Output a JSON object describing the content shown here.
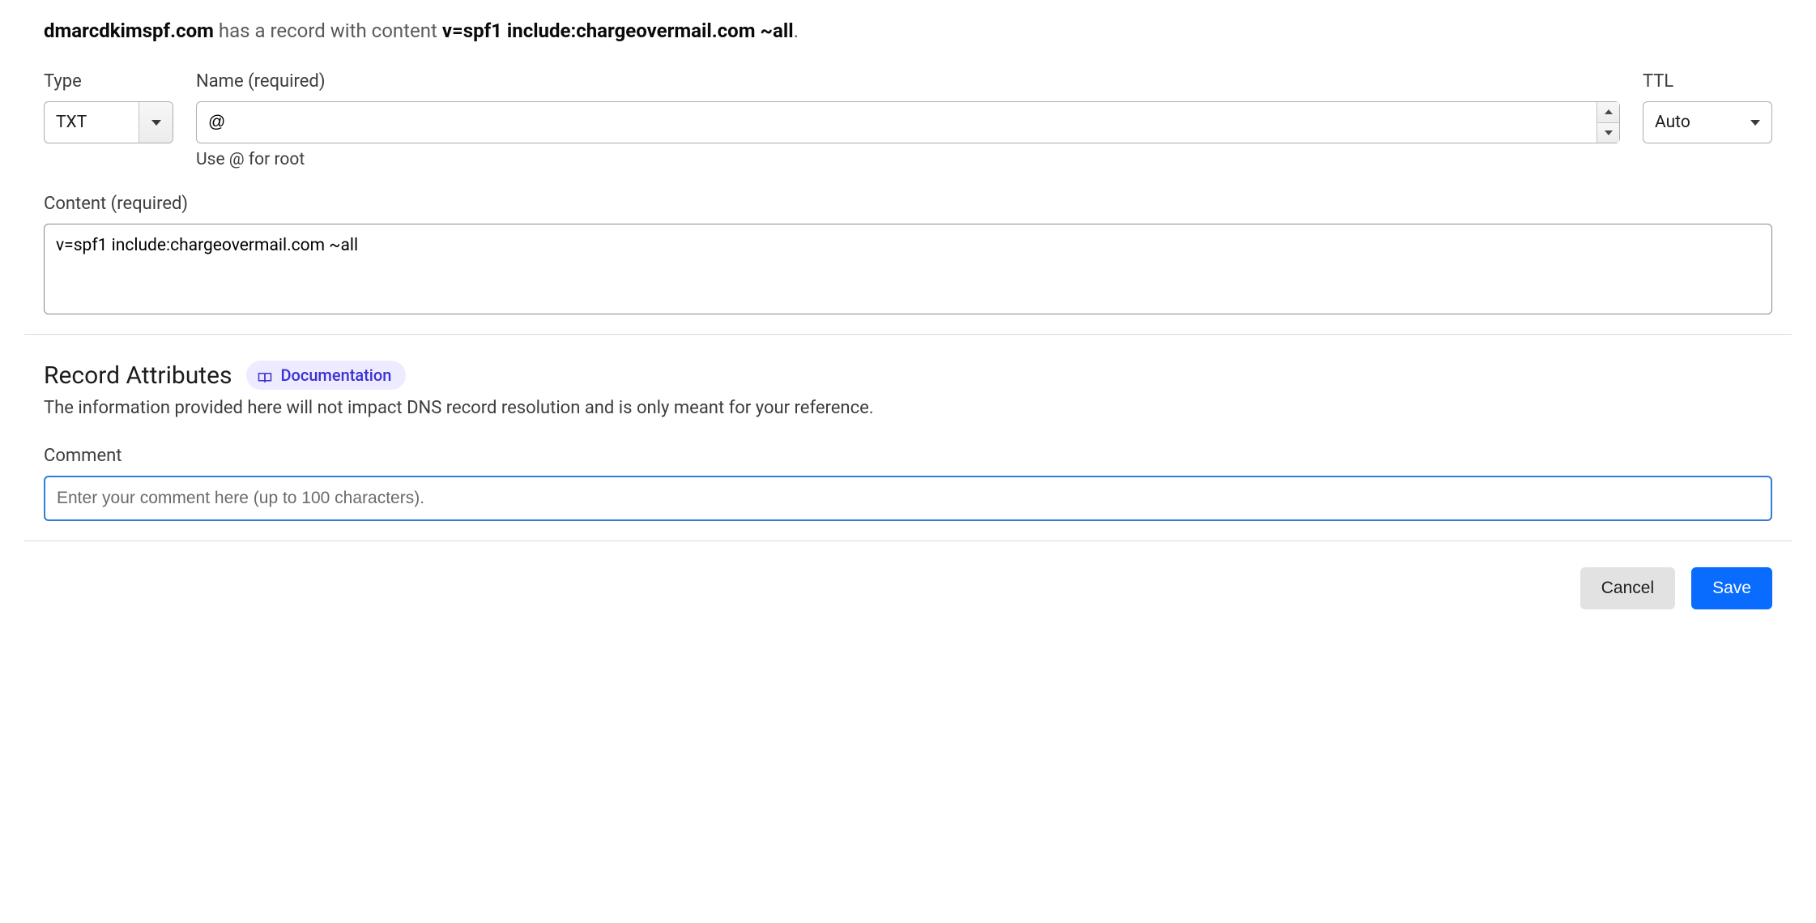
{
  "heading": {
    "domain": "dmarcdkimspf.com",
    "mid": " has a record with content ",
    "content_value": "v=spf1 include:chargeovermail.com ~all",
    "tail": "."
  },
  "fields": {
    "type": {
      "label": "Type",
      "value": "TXT"
    },
    "name": {
      "label": "Name (required)",
      "value": "@",
      "helper": "Use @ for root"
    },
    "ttl": {
      "label": "TTL",
      "value": "Auto"
    },
    "content": {
      "label": "Content (required)",
      "value": "v=spf1 include:chargeovermail.com ~all"
    }
  },
  "attributes": {
    "title": "Record Attributes",
    "doc_label": "Documentation",
    "description": "The information provided here will not impact DNS record resolution and is only meant for your reference.",
    "comment": {
      "label": "Comment",
      "placeholder": "Enter your comment here (up to 100 characters).",
      "value": ""
    }
  },
  "buttons": {
    "cancel": "Cancel",
    "save": "Save"
  }
}
